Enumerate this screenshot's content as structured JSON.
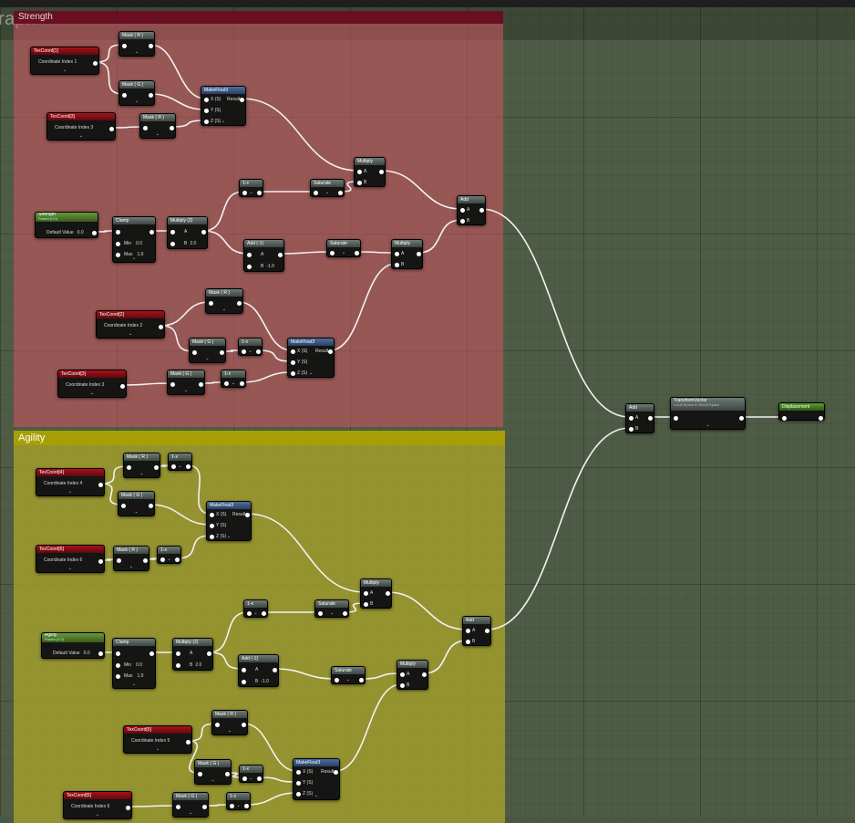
{
  "graph_title": "raph",
  "comments": {
    "strength": "Strength",
    "agility": "Agility"
  },
  "labels": {
    "texcoord": [
      "TexCoord[1]",
      "TexCoord[3]",
      "TexCoord[2]",
      "TexCoord[3]",
      "TexCoord[4]",
      "TexCoord[6]",
      "TexCoord[5]",
      "TexCoord[6]"
    ],
    "coord_index": "Coordinate Index",
    "coord_values": [
      "1",
      "3",
      "2",
      "3",
      "4",
      "6",
      "5",
      "6"
    ],
    "mask_r": "Mask ( R )",
    "mask_g": "Mask ( G )",
    "make_float3": "MakeFloat3",
    "x_s": "X (S)",
    "y_s": "Y (S)",
    "z_s": "Z (S)",
    "result": "Result",
    "multiply": "Multiply",
    "multiply_2": "Multiply (2)",
    "add": "Add",
    "add_neg1": "Add (-1)",
    "one_minus": "1-x",
    "saturate": "Saturate",
    "clamp": "Clamp",
    "min": "Min",
    "max": "Max",
    "min_val": "0.0",
    "max_val": "1.0",
    "pin_a": "A",
    "pin_b": "B",
    "b_2": "2.0",
    "b_neg1": "-1.0",
    "strength_param": "Strength",
    "agility_param": "Agility",
    "param_sub": "Param (0.0)",
    "default_value": "Default Value",
    "default_val": "0.0",
    "transform_vector": "TransformVector",
    "transform_sub": "Local Space to World Space",
    "displacement": "Displacement"
  }
}
